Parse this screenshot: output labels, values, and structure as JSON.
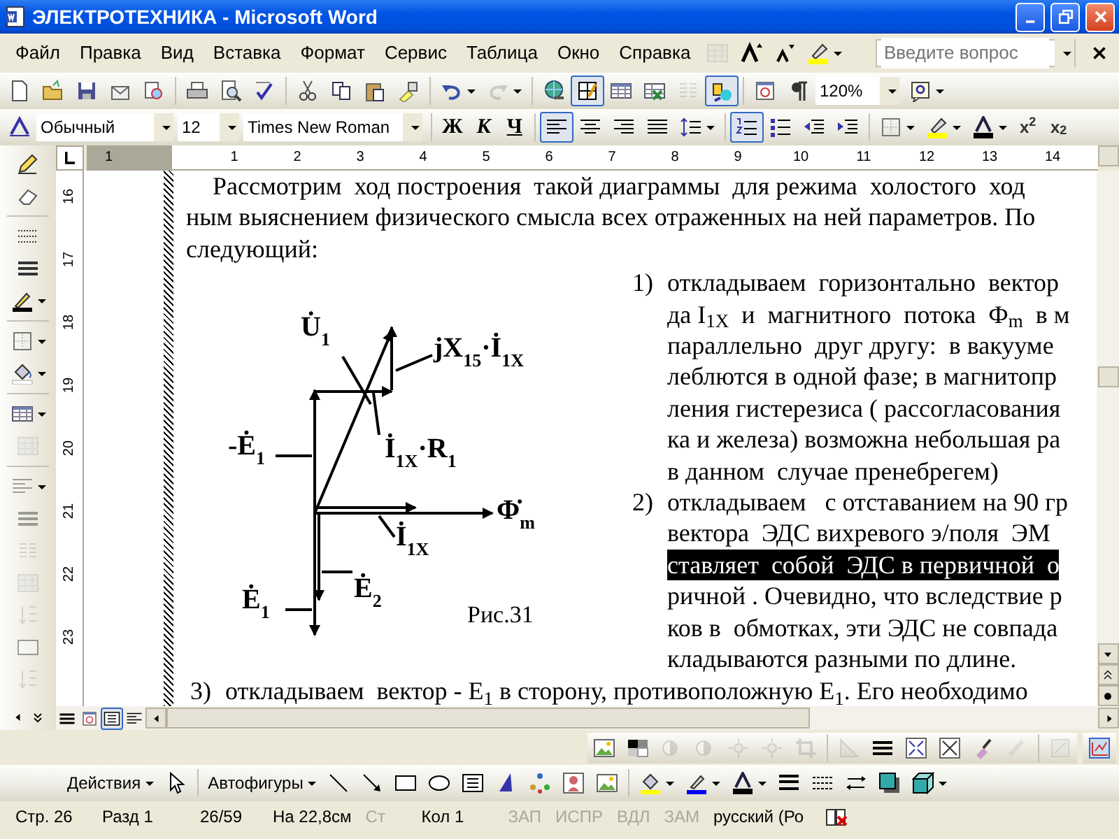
{
  "window": {
    "title": "ЭЛЕКТРОТЕХНИКА - Microsoft Word"
  },
  "menu": [
    "Файл",
    "Правка",
    "Вид",
    "Вставка",
    "Формат",
    "Сервис",
    "Таблица",
    "Окно",
    "Справка"
  ],
  "help_box": {
    "placeholder": "Введите вопрос"
  },
  "standard_toolbar": {
    "tables_borders_pressed": true,
    "drawing_pressed": true,
    "redo_disabled": true,
    "zoom": "120%"
  },
  "formatting_toolbar": {
    "style": "Обычный",
    "size": "12",
    "font": "Times New Roman",
    "bold": "Ж",
    "italic": "К",
    "underline": "Ч",
    "alignment": [
      {
        "selected": true
      },
      {
        "selected": false
      },
      {
        "selected": false
      },
      {
        "selected": false
      }
    ],
    "numbering_pressed": true,
    "bullets_pressed": false,
    "superscript": "x$^{2}$",
    "subscript": "x$_{2}$"
  },
  "ruler": {
    "horizontal": [
      "1",
      "1",
      "2",
      "3",
      "4",
      "5",
      "6",
      "7",
      "8",
      "9",
      "10",
      "11",
      "12",
      "13",
      "14"
    ],
    "vertical": [
      "16",
      "17",
      "18",
      "19",
      "20",
      "21",
      "22",
      "23"
    ]
  },
  "document": {
    "intro": [
      "Рассмотрим  ход построения  такой диаграммы  для режима  холостого  ход",
      "ным выяснением физического смысла всех отраженных на ней параметров. По",
      "следующий:"
    ],
    "figure": {
      "labels": [
        "U̇$_{1}$",
        "jX$_{15}$·İ$_{1X}$",
        "-Ė$_{1}$",
        "İ$_{1X}$·R$_{1}$",
        "Φ̇$_{m}$",
        "İ$_{1X}$",
        "Ė$_{1}$",
        "Ė$_{2}$"
      ],
      "caption": "Рис.31"
    },
    "list": [
      {
        "number": "1)",
        "lines": [
          {
            "text": "откладываем  горизонтально  вектор",
            "selected": false
          },
          {
            "text": "да I$_{1X}$  и  магнитного  потока  Ф$_{m}$  в м",
            "selected": false
          },
          {
            "text": "параллельно  друг другу:  в вакууме",
            "selected": false
          },
          {
            "text": "леблются в одной фазе; в магнитопр",
            "selected": false
          },
          {
            "text": "ления гистерезиса ( рассогласования",
            "selected": false
          },
          {
            "text": "ка и железа) возможна небольшая ра",
            "selected": false
          },
          {
            "text": "в данном  случае пренебрегем)",
            "selected": false
          }
        ]
      },
      {
        "number": "2)",
        "lines": [
          {
            "text": "откладываем   с отставанием на 90 гр",
            "selected": false
          },
          {
            "text": "вектора  ЭДС вихревого э/поля  ЭМ",
            "selected": false
          },
          {
            "text": "ставляет  собой  ЭДС в первичной  о",
            "selected": true
          },
          {
            "text": "ричной . Очевидно, что вследствие р",
            "selected": false
          },
          {
            "text": "ков в  обмотках, эти ЭДС не совпада",
            "selected": false
          },
          {
            "text": "кладываются разными по длине.",
            "selected": false
          }
        ]
      }
    ],
    "item3": {
      "number": "3)",
      "text": "откладываем  вектор - E$_{1}$ в сторону, противоположную E$_{1}$. Его необходимо"
    }
  },
  "drawing_toolbar": {
    "actions": "Действия",
    "autoshapes": "Автофигуры"
  },
  "status_bar": [
    {
      "text": "Стр. 26",
      "disabled": false
    },
    {
      "text": "Разд 1",
      "disabled": false
    },
    {
      "text": "26/59",
      "disabled": false
    },
    {
      "text": "На 22,8см",
      "disabled": false
    },
    {
      "text": "Ст",
      "disabled": true
    },
    {
      "text": "Кол 1",
      "disabled": false
    },
    {
      "text": "ЗАП",
      "disabled": true
    },
    {
      "text": "ИСПР",
      "disabled": true
    },
    {
      "text": "ВДЛ",
      "disabled": true
    },
    {
      "text": "ЗАМ",
      "disabled": true
    },
    {
      "text": "русский (Ро",
      "disabled": false
    }
  ]
}
